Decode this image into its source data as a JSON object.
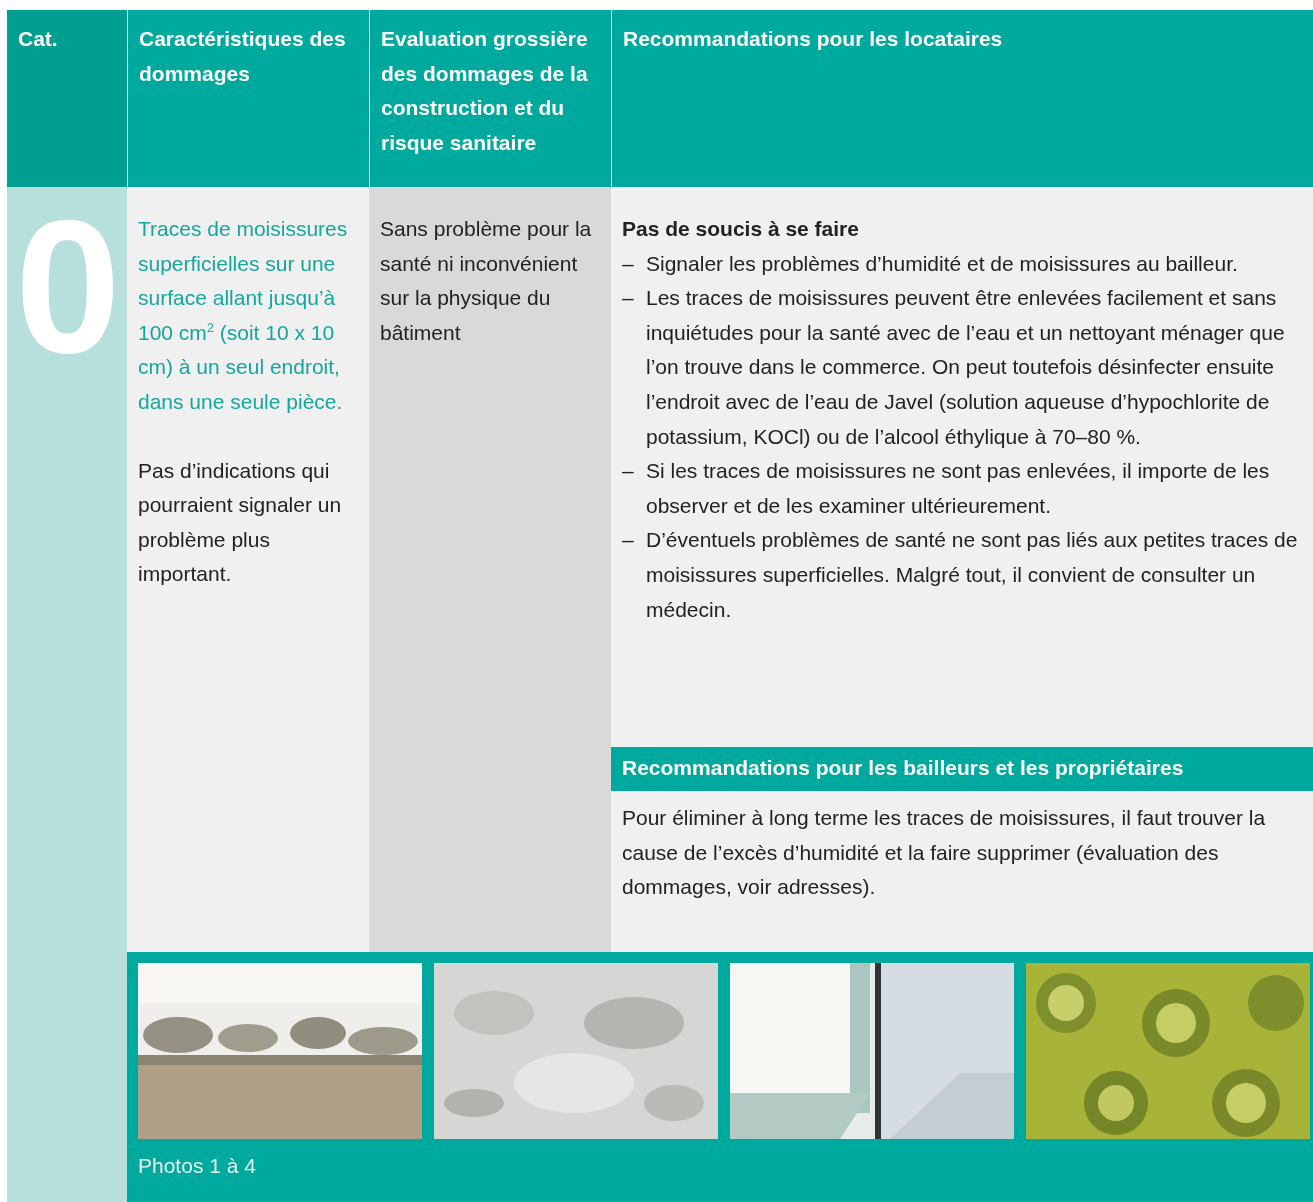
{
  "header": {
    "columns": [
      {
        "label": "Cat."
      },
      {
        "label": "Caractéristiques des dommages"
      },
      {
        "label": "Evaluation grossière des dommages de la construction et du risque sanitaire"
      },
      {
        "label": "Recommandations pour les locataires"
      }
    ]
  },
  "category": {
    "number": "0"
  },
  "damage": {
    "description": "Traces de moisissures superficielles sur une surface allant jusqu’à 100 cm$^{2}$ (soit 10 x 10 cm) à un seul endroit, dans une seule pièce.",
    "note": "Pas d’indications qui pourraient signaler un problème plus important."
  },
  "evaluation": {
    "text": "Sans problème pour la santé ni inconvénient sur la physique du bâtiment"
  },
  "tenants": {
    "title": "Pas de soucis à se faire",
    "items": [
      {
        "bullet": "–",
        "text": "Signaler les problèmes d’humidité et de moisissures au bailleur."
      },
      {
        "bullet": "–",
        "text": "Les traces de moisissures peuvent être enlevées facilement et sans inquiétudes pour la santé avec de l’eau et un nettoyant ménager que l’on trouve dans le commerce. On peut toutefois désinfecter ensuite l’endroit avec de l’eau de Javel (solution aqueuse d’hypochlorite de potassium, KOCl) ou de l’alcool éthylique à 70–80 %."
      },
      {
        "bullet": "–",
        "text": "Si les traces de moisissures ne sont pas enlevées, il importe de les observer et de les examiner ultérieurement."
      },
      {
        "bullet": "–",
        "text": "D’éventuels problèmes de santé ne sont pas liés aux petites traces de moisissures superficielles. Malgré tout, il convient de consulter un médecin."
      }
    ]
  },
  "landlords": {
    "heading": "Recommandations pour les bailleurs et les propriétaires",
    "text": "Pour éliminer à long terme les traces de moisissures, il faut trouver la cause de l’excès d’humidité et la faire supprimer (évaluation des dommages, voir adresses)."
  },
  "photos": [
    {
      "kind": "wall"
    },
    {
      "kind": "plaster"
    },
    {
      "kind": "window"
    },
    {
      "kind": "tile"
    }
  ],
  "photos_caption": "Photos 1 à 4"
}
